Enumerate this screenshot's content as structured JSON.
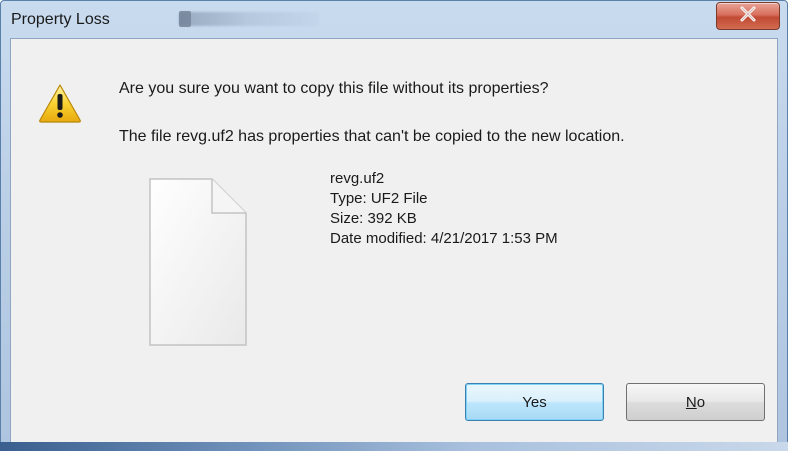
{
  "window": {
    "title": "Property Loss"
  },
  "dialog": {
    "question": "Are you sure you want to copy this file without its properties?",
    "explanation": "The file revg.uf2 has properties that can't be copied to the new location."
  },
  "file": {
    "name": "revg.uf2",
    "type": "Type: UF2 File",
    "size": "Size: 392 KB",
    "date_modified": "Date modified: 4/21/2017 1:53 PM"
  },
  "buttons": {
    "yes_label": "Yes",
    "no_label_mnemonic": "N",
    "no_label_rest": "o"
  },
  "icons": {
    "warning": "warning-icon",
    "file": "file-icon",
    "close": "close-icon"
  },
  "colors": {
    "close_button": "#c9503a",
    "default_button_border": "#3c7fb1",
    "dialog_bg": "#f0f0f0"
  }
}
